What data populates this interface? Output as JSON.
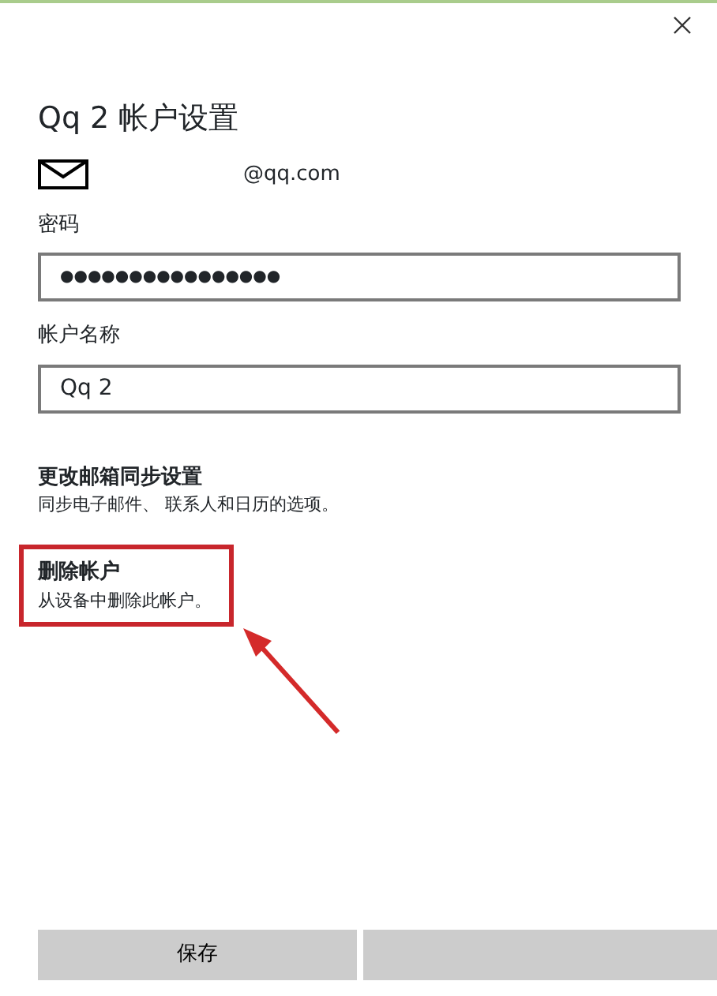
{
  "title": "Qq 2 帐户设置",
  "email": "@qq.com",
  "fields": [
    {
      "label": "密码",
      "kind": "password",
      "value": "●●●●●●●●●●●●●●●●"
    },
    {
      "label": "帐户名称",
      "kind": "text",
      "value": "Qq 2"
    }
  ],
  "links": [
    {
      "title": "更改邮箱同步设置",
      "description": "同步电子邮件、 联系人和日历的选项。",
      "highlighted": false
    },
    {
      "title": "删除帐户",
      "description": "从设备中删除此帐户。",
      "highlighted": true
    }
  ],
  "buttons": [
    {
      "kind": "labeled",
      "label": "保存"
    },
    {
      "kind": "blank"
    }
  ]
}
